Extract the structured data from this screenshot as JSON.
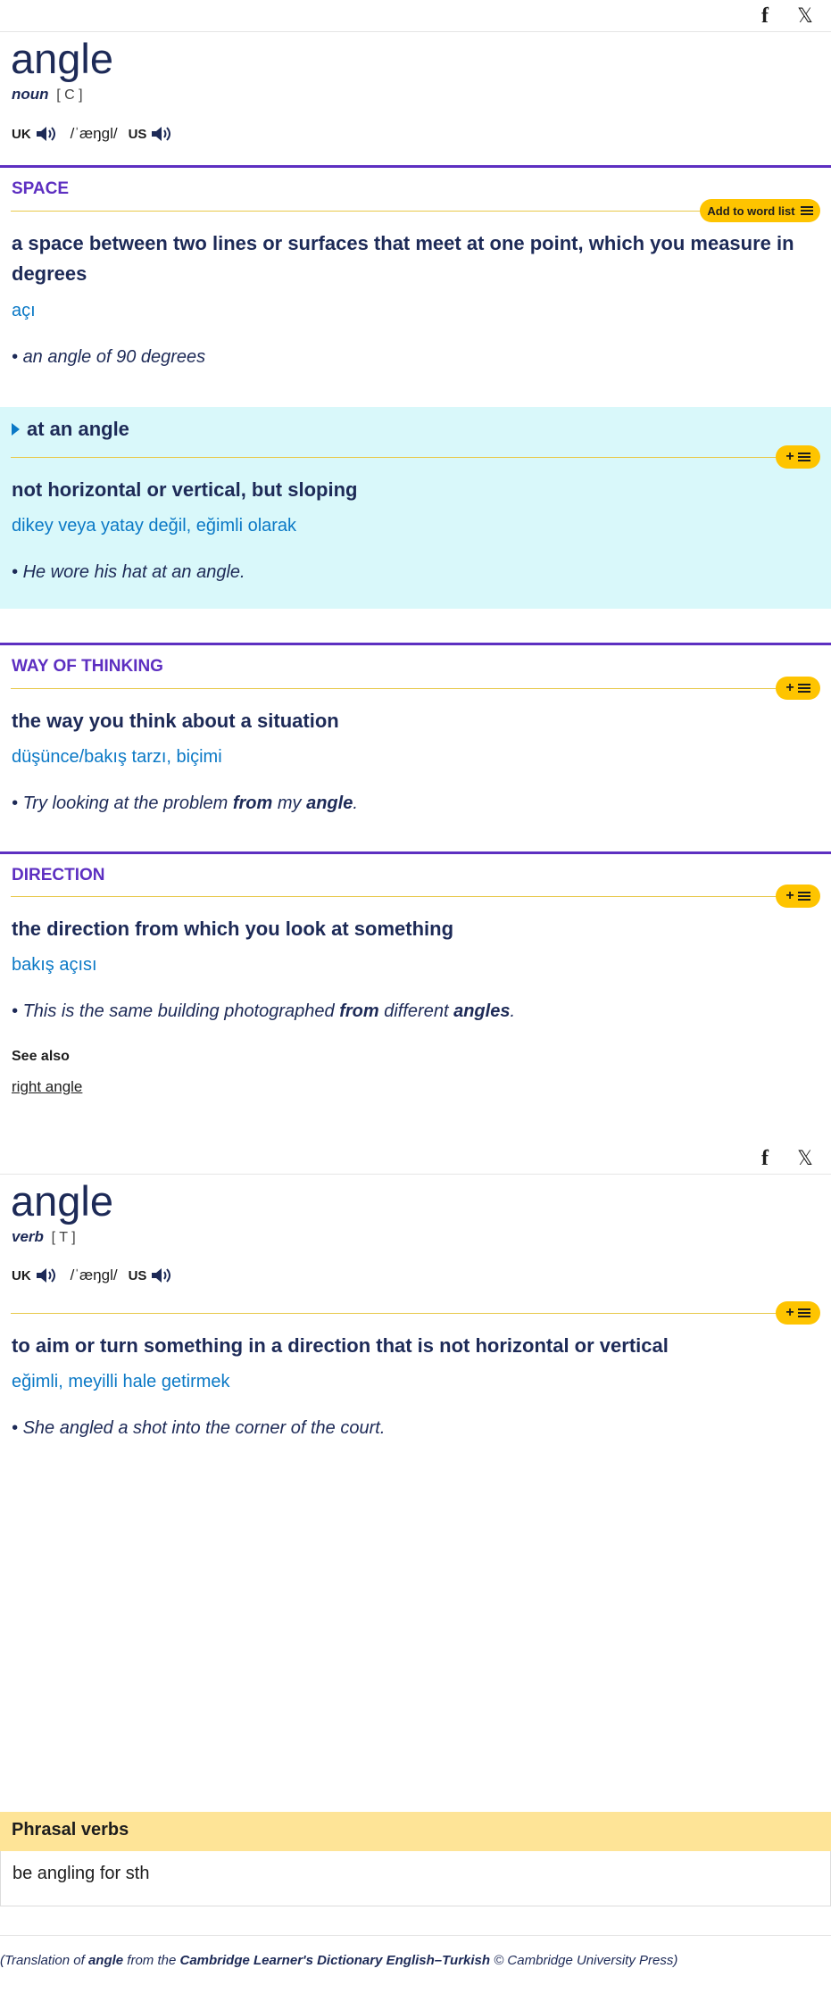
{
  "share": {
    "facebook_icon": "facebook-icon",
    "x_icon": "x-icon"
  },
  "entries": [
    {
      "headword": "angle",
      "pos": "noun",
      "grammar": "[ C ]",
      "uk_label": "UK",
      "ipa": "/ˈæŋɡl/",
      "us_label": "US"
    },
    {
      "headword": "angle",
      "pos": "verb",
      "grammar": "[ T ]",
      "uk_label": "UK",
      "ipa": "/ˈæŋɡl/",
      "us_label": "US"
    }
  ],
  "add_to_word_list": "Add to word list",
  "senses": {
    "space": {
      "label": "SPACE",
      "definition": "a space between two lines or surfaces that meet at one point, which you measure in degrees",
      "translation": "açı",
      "example": "an angle of 90 degrees"
    },
    "at_an_angle": {
      "phrase": "at an angle",
      "definition": "not horizontal or vertical, but sloping",
      "translation": "dikey veya yatay değil, eğimli olarak",
      "example": "He wore his hat at an angle."
    },
    "way_of_thinking": {
      "label": "WAY OF THINKING",
      "definition": "the way you think about a situation",
      "translation": "düşünce/bakış tarzı, biçimi",
      "example_pre": "Try looking at the problem ",
      "example_b1": "from",
      "example_mid": " my ",
      "example_b2": "angle",
      "example_post": "."
    },
    "direction": {
      "label": "DIRECTION",
      "definition": "the direction from which you look at something",
      "translation": "bakış açısı",
      "example_pre": "This is the same building photographed ",
      "example_b1": "from",
      "example_mid": " different ",
      "example_b2": "angles",
      "example_post": ".",
      "see_also_label": "See also",
      "see_also_link": "right angle"
    },
    "verb": {
      "definition": "to aim or turn something in a direction that is not horizontal or vertical",
      "translation": "eğimli, meyilli hale getirmek",
      "example": "She angled a shot into the corner of the court."
    }
  },
  "phrasal_verbs": {
    "heading": "Phrasal verbs",
    "items": [
      "be angling for sth"
    ]
  },
  "footer": {
    "pre": "(Translation of ",
    "word": "angle",
    "mid": " from the ",
    "dict": "Cambridge Learner's Dictionary English–Turkish",
    "post": " © Cambridge University Press)"
  }
}
